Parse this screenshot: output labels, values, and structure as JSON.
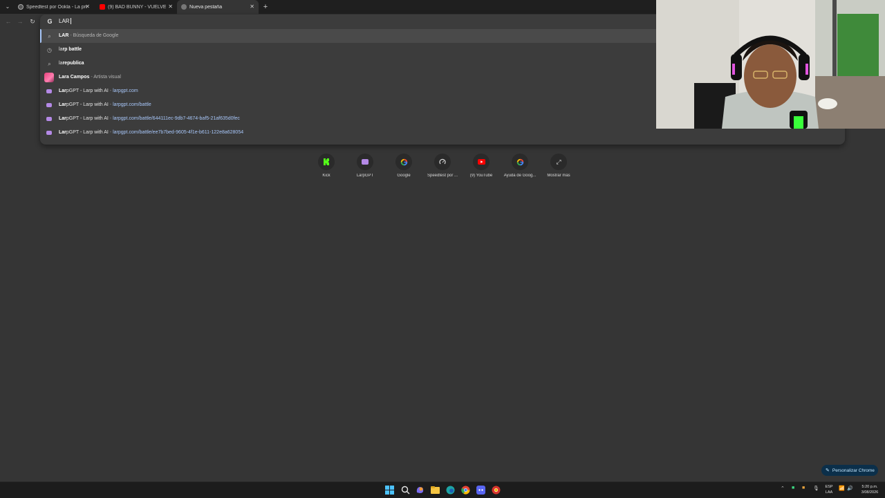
{
  "tabs": [
    {
      "title": "Speedtest por Ookla - La prueba",
      "favicon": "speedtest-icon",
      "active": false
    },
    {
      "title": "(9) BAD BUNNY - VUELVE CANDY",
      "favicon": "youtube-icon",
      "active": false
    },
    {
      "title": "Nueva pestaña",
      "favicon": "chrome-icon",
      "active": true
    }
  ],
  "omnibox": {
    "typed": "LAR",
    "suggestions": [
      {
        "icon": "search-icon",
        "bold": "LAR",
        "rest": "",
        "sep": " - ",
        "desc": "Búsqueda de Google",
        "url": ""
      },
      {
        "icon": "history-icon",
        "bold": "la",
        "rest": "rp battle",
        "sep": "",
        "desc": "",
        "url": ""
      },
      {
        "icon": "search-icon",
        "bold": "la",
        "rest": "republica",
        "sep": "",
        "desc": "",
        "url": ""
      },
      {
        "icon": "avatar-icon",
        "bold": "Lar",
        "rest": "a Campos",
        "sep": " - ",
        "desc": "Artista visual",
        "url": ""
      },
      {
        "icon": "larpgpt-icon",
        "bold": "Lar",
        "rest": "pGPT - Larp with AI",
        "sep": " - ",
        "desc": "",
        "url": "larpgpt.com"
      },
      {
        "icon": "larpgpt-icon",
        "bold": "Lar",
        "rest": "pGPT - Larp with AI",
        "sep": " - ",
        "desc": "",
        "url": "larpgpt.com/battle"
      },
      {
        "icon": "larpgpt-icon",
        "bold": "Lar",
        "rest": "pGPT - Larp with AI",
        "sep": " - ",
        "desc": "",
        "url": "larpgpt.com/battle/644111ec-9db7-4674-baf5-21af635d0fec"
      },
      {
        "icon": "larpgpt-icon",
        "bold": "Lar",
        "rest": "pGPT - Larp with AI",
        "sep": " - ",
        "desc": "",
        "url": "larpgpt.com/battle/ee7b7bed-9605-4f1e-b611-122e8a628054"
      }
    ]
  },
  "shortcuts": [
    {
      "label": "Kick",
      "icon": "kick-icon"
    },
    {
      "label": "LarpGPT",
      "icon": "larpgpt-icon"
    },
    {
      "label": "Google",
      "icon": "google-icon"
    },
    {
      "label": "Speedtest por ...",
      "icon": "speedtest-icon"
    },
    {
      "label": "(9) YouTube",
      "icon": "youtube-icon"
    },
    {
      "label": "Ayuda de Goog...",
      "icon": "google-icon"
    },
    {
      "label": "Mostrar más",
      "icon": "expand-icon"
    }
  ],
  "customize_label": "Personalizar Chrome",
  "taskbar": {
    "lang_line1": "ESP",
    "lang_line2": "LAA",
    "time": "5:20 p.m.",
    "date": "3/08/2026"
  }
}
